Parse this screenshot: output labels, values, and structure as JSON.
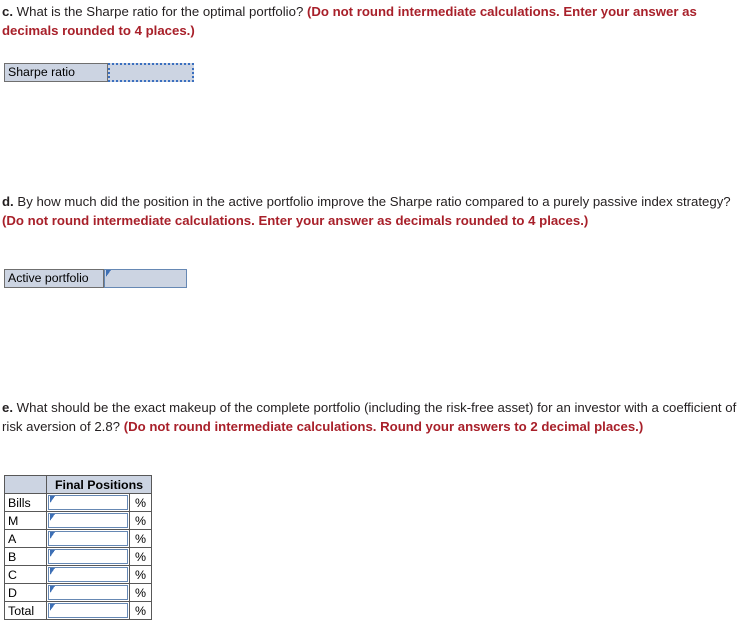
{
  "colors": {
    "red_emphasis": "#a8202a",
    "body_text": "#231f20",
    "label_fill": "#ccd4e2",
    "field_border": "#6688b4",
    "dotted_border": "#3a6fbf",
    "table_border": "#585858"
  },
  "questions": [
    {
      "id": "question-c",
      "letter": "c.",
      "prompt": " What is the Sharpe ratio for the optimal portfolio? ",
      "emphasis": "(Do not round intermediate calculations. Enter your answer as decimals rounded to 4 places.)"
    },
    {
      "id": "question-d",
      "letter": "d.",
      "prompt": " By how much did the position in the active portfolio improve the Sharpe ratio compared to a purely passive index strategy? ",
      "emphasis": "(Do not round intermediate calculations. Enter your answer as decimals rounded to 4 places.)"
    },
    {
      "id": "question-e",
      "letter": "e.",
      "prompt": " What should be the exact makeup of the complete portfolio (including the risk-free asset) for an investor with a coefficient of risk aversion of 2.8? ",
      "emphasis": "(Do not round intermediate calculations. Round your answers to 2 decimal places.)"
    }
  ],
  "answer_c": {
    "label": "Sharpe ratio",
    "value": "",
    "placeholder": ""
  },
  "answer_d": {
    "label": "Active portfolio",
    "value": "",
    "placeholder": ""
  },
  "final_positions_table": {
    "corner_header": "",
    "column_header": "Final Positions",
    "unit_symbol": "%",
    "rows": [
      {
        "label": "Bills",
        "value": "",
        "unit": "%"
      },
      {
        "label": "M",
        "value": "",
        "unit": "%"
      },
      {
        "label": "A",
        "value": "",
        "unit": "%"
      },
      {
        "label": "B",
        "value": "",
        "unit": "%"
      },
      {
        "label": "C",
        "value": "",
        "unit": "%"
      },
      {
        "label": "D",
        "value": "",
        "unit": "%"
      },
      {
        "label": "Total",
        "value": "",
        "unit": "%"
      }
    ]
  }
}
